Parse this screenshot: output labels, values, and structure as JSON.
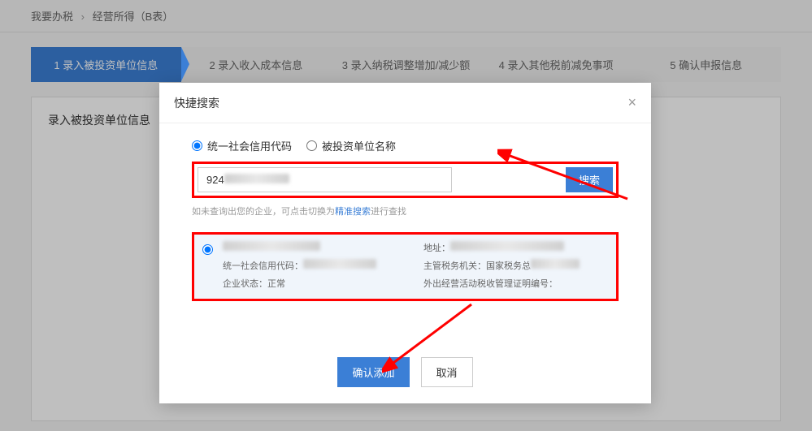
{
  "breadcrumb": {
    "item1": "我要办税",
    "item2": "经营所得（B表）"
  },
  "steps": {
    "s1": "1  录入被投资单位信息",
    "s2": "2  录入收入成本信息",
    "s3": "3  录入纳税调整增加/减少额",
    "s4": "4  录入其他税前减免事项",
    "s5": "5  确认申报信息"
  },
  "panel": {
    "title": "录入被投资单位信息"
  },
  "modal": {
    "title": "快捷搜索",
    "radio1": "统一社会信用代码",
    "radio2": "被投资单位名称",
    "search_value": "924",
    "search_btn": "搜索",
    "hint_prefix": "如未查询出您的企业，可点击切换为",
    "hint_link": "精准搜索",
    "hint_suffix": "进行查找",
    "result": {
      "label_code": "统一社会信用代码：",
      "label_addr": "地址：",
      "label_tax": "主管税务机关：",
      "tax_value": "国家税务总",
      "label_status": "企业状态：",
      "status_value": "正常",
      "label_cert": "外出经营活动税收管理证明编号："
    },
    "confirm": "确认添加",
    "cancel": "取消"
  }
}
